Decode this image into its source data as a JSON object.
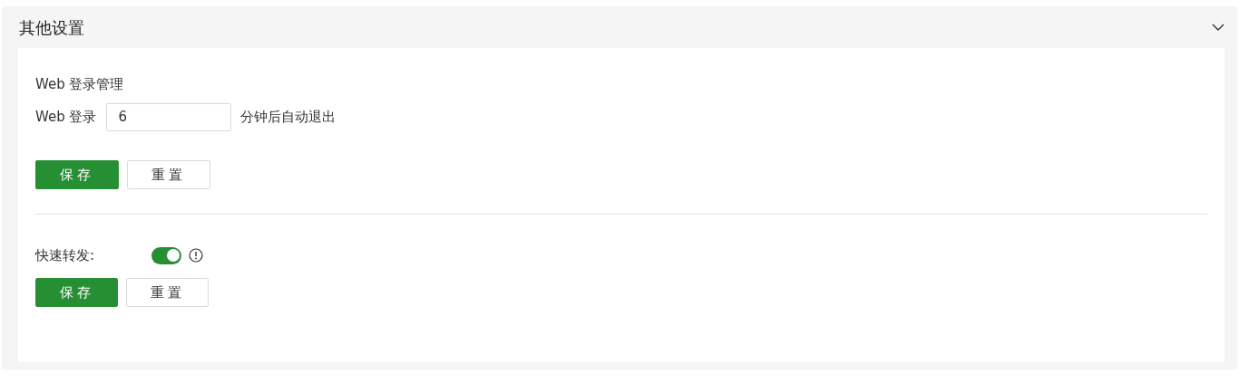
{
  "panel": {
    "title": "其他设置",
    "expanded": true
  },
  "web_login": {
    "heading": "Web 登录管理",
    "label": "Web 登录",
    "value": "6",
    "suffix": "分钟后自动退出",
    "buttons": [
      {
        "label": "保存",
        "kind": "primary"
      },
      {
        "label": "重置",
        "kind": "secondary"
      }
    ]
  },
  "fast_forward": {
    "label": "快速转发:",
    "on": true,
    "buttons": [
      {
        "label": "保存",
        "kind": "primary"
      },
      {
        "label": "重置",
        "kind": "secondary"
      }
    ]
  }
}
